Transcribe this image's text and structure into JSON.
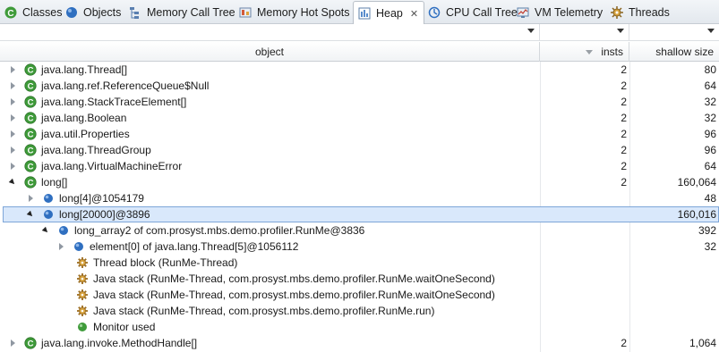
{
  "tabs": [
    {
      "label": "Classes",
      "icon": "classes-icon"
    },
    {
      "label": "Objects",
      "icon": "objects-icon"
    },
    {
      "label": "Memory Call Tree",
      "icon": "memory-call-tree-icon"
    },
    {
      "label": "Memory Hot Spots",
      "icon": "memory-hot-spots-icon"
    },
    {
      "label": "Heap",
      "icon": "heap-icon",
      "active": true
    },
    {
      "label": "CPU Call Tree",
      "icon": "cpu-call-tree-icon"
    },
    {
      "label": "VM Telemetry",
      "icon": "vm-telemetry-icon"
    },
    {
      "label": "Threads",
      "icon": "threads-icon"
    }
  ],
  "close_glyph": "✕",
  "columns": {
    "object": "object",
    "insts": "insts",
    "shallow": "shallow size"
  },
  "rows": [
    {
      "name": "java.lang.Thread[]",
      "insts": "2",
      "shallow": "80",
      "icon": "class-icon",
      "expand": "closed"
    },
    {
      "name": "java.lang.ref.ReferenceQueue$Null",
      "insts": "2",
      "shallow": "64",
      "icon": "class-icon",
      "expand": "closed"
    },
    {
      "name": "java.lang.StackTraceElement[]",
      "insts": "2",
      "shallow": "32",
      "icon": "class-icon",
      "expand": "closed"
    },
    {
      "name": "java.lang.Boolean",
      "insts": "2",
      "shallow": "32",
      "icon": "class-icon",
      "expand": "closed"
    },
    {
      "name": "java.util.Properties",
      "insts": "2",
      "shallow": "96",
      "icon": "class-icon",
      "expand": "closed"
    },
    {
      "name": "java.lang.ThreadGroup",
      "insts": "2",
      "shallow": "96",
      "icon": "class-icon",
      "expand": "closed"
    },
    {
      "name": "java.lang.VirtualMachineError",
      "insts": "2",
      "shallow": "64",
      "icon": "class-icon",
      "expand": "closed"
    },
    {
      "name": "long[]",
      "insts": "2",
      "shallow": "160,064",
      "icon": "class-icon",
      "expand": "open"
    },
    {
      "name": "long[4]@1054179",
      "insts": "",
      "shallow": "48",
      "icon": "object-icon",
      "expand": "closed"
    },
    {
      "name": "long[20000]@3896",
      "insts": "",
      "shallow": "160,016",
      "icon": "object-icon",
      "expand": "open",
      "selected": true
    },
    {
      "name": "long_array2 of com.prosyst.mbs.demo.profiler.RunMe@3836",
      "insts": "",
      "shallow": "392",
      "icon": "object-icon",
      "expand": "open"
    },
    {
      "name": "element[0] of java.lang.Thread[5]@1056112",
      "insts": "",
      "shallow": "32",
      "icon": "object-icon",
      "expand": "closed"
    },
    {
      "name": "Thread block (RunMe-Thread)",
      "insts": "",
      "shallow": "",
      "icon": "gc-root-gear-icon",
      "expand": "none"
    },
    {
      "name": "Java stack (RunMe-Thread, com.prosyst.mbs.demo.profiler.RunMe.waitOneSecond)",
      "insts": "",
      "shallow": "",
      "icon": "gc-root-gear-icon",
      "expand": "none"
    },
    {
      "name": "Java stack (RunMe-Thread, com.prosyst.mbs.demo.profiler.RunMe.waitOneSecond)",
      "insts": "",
      "shallow": "",
      "icon": "gc-root-gear-icon",
      "expand": "none"
    },
    {
      "name": "Java stack (RunMe-Thread, com.prosyst.mbs.demo.profiler.RunMe.run)",
      "insts": "",
      "shallow": "",
      "icon": "gc-root-gear-icon",
      "expand": "none"
    },
    {
      "name": "Monitor used",
      "insts": "",
      "shallow": "",
      "icon": "monitor-icon",
      "expand": "none"
    },
    {
      "name": "java.lang.invoke.MethodHandle[]",
      "insts": "2",
      "shallow": "1,064",
      "icon": "class-icon",
      "expand": "closed"
    }
  ],
  "colors": {
    "selection": "#d9e8fb",
    "selection_border": "#7ea6d8",
    "class_green": "#3f9b3a",
    "object_blue": "#2f6fc0",
    "gear_orange": "#c68a2a"
  }
}
